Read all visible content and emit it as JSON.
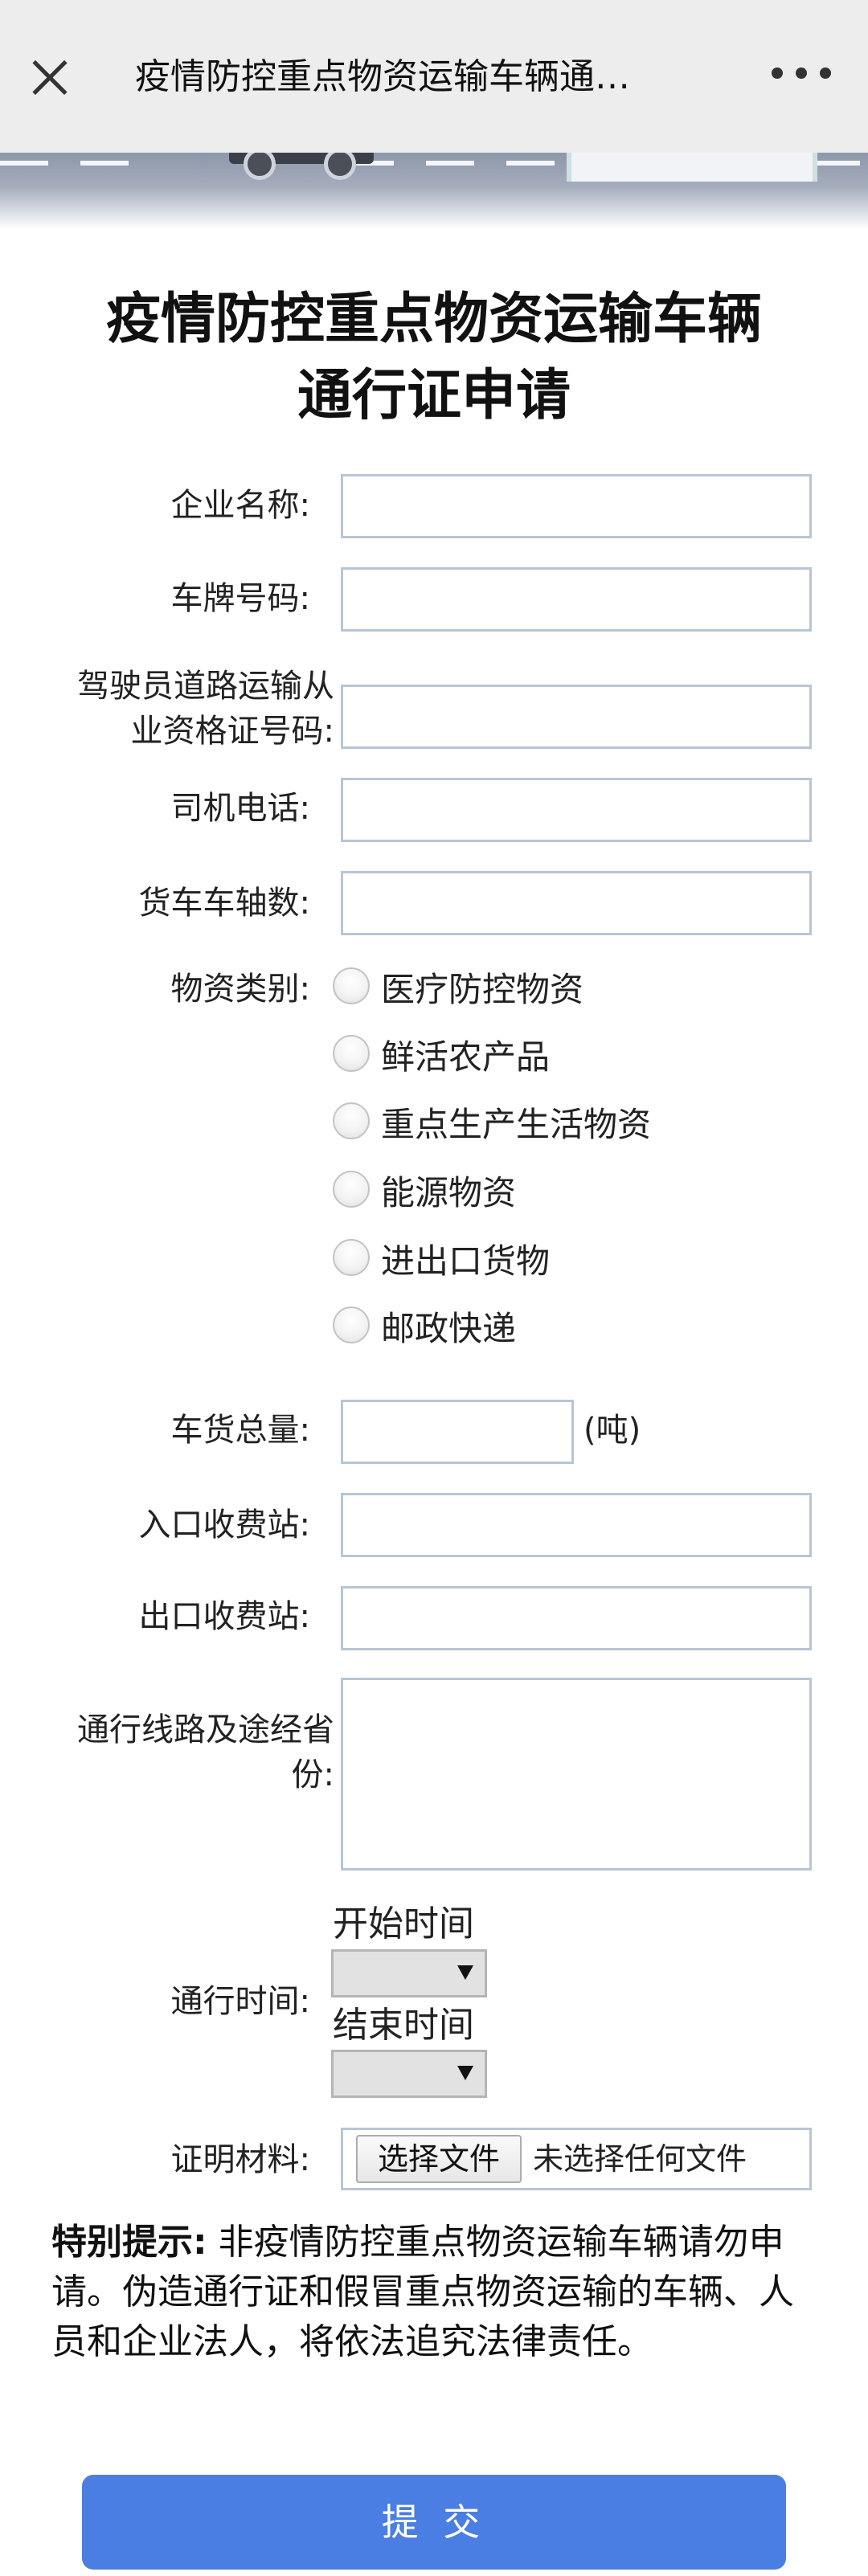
{
  "topbar": {
    "title": "疫情防控重点物资运输车辆通…",
    "close_icon": "close-icon",
    "more_icon": "more-icon"
  },
  "form": {
    "title_line1": "疫情防控重点物资运输车辆",
    "title_line2": "通行证申请",
    "company_label": "企业名称:",
    "plate_label": "车牌号码:",
    "driver_cert_label_line1": "驾驶员道路运输从",
    "driver_cert_label_line2": "业资格证号码:",
    "phone_label": "司机电话:",
    "axle_label": "货车车轴数:",
    "category_label": "物资类别:",
    "categories": [
      "医疗防控物资",
      "鲜活农产品",
      "重点生产生活物资",
      "能源物资",
      "进出口货物",
      "邮政快递"
    ],
    "weight_label": "车货总量:",
    "weight_unit": "(吨)",
    "entry_label": "入口收费站:",
    "exit_label": "出口收费站:",
    "route_label_line1": "通行线路及途经省",
    "route_label_line2": "份:",
    "time_label": "通行时间:",
    "start_time_label": "开始时间",
    "end_time_label": "结束时间",
    "proof_label": "证明材料:",
    "file_button": "选择文件",
    "file_status": "未选择任何文件"
  },
  "notice": {
    "bold_prefix": "特别提示:",
    "text": " 非疫情防控重点物资运输车辆请勿申请。伪造通行证和假冒重点物资运输的车辆、人员和企业法人，将依法追究法律责任。"
  },
  "submit_label": "提 交"
}
